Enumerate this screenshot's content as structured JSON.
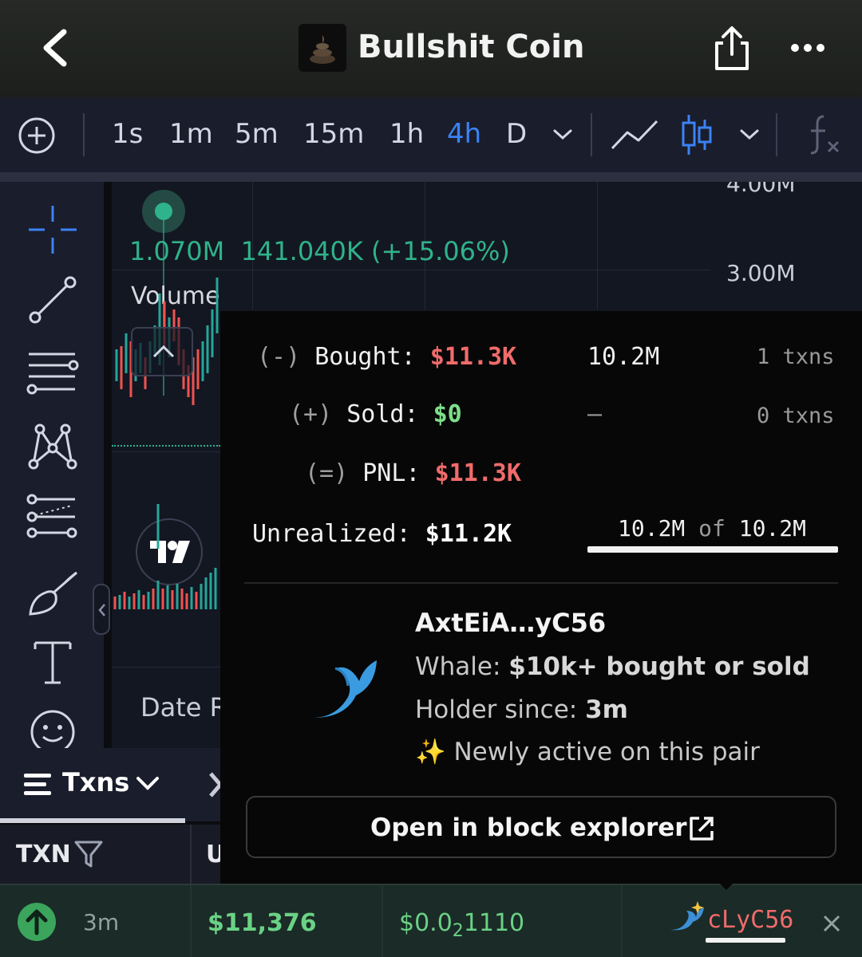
{
  "header": {
    "title": "Bullshit Coin",
    "icons": [
      "back-chevron-icon",
      "coin-logo",
      "share-icon",
      "more-icon"
    ]
  },
  "timeframes": {
    "items": [
      "1s",
      "1m",
      "5m",
      "15m",
      "1h",
      "4h",
      "D"
    ],
    "active": "4h",
    "accent_color": "#3b82f6"
  },
  "chart": {
    "price_labels": [
      "4.00M",
      "3.00M"
    ],
    "stats_value": "1.070M",
    "stats_change": "141.040K (+15.06%)",
    "volume_label": "Volume",
    "date_label": "Date R"
  },
  "txns": {
    "tab_label": "Txns",
    "column_txn": "TXN",
    "column_u": "U",
    "row": {
      "age": "3m",
      "usd": "$11,376",
      "price_prefix": "$0.0",
      "price_sub": "2",
      "price_suffix": "1110",
      "maker": "cLyC56"
    }
  },
  "popup": {
    "bought_sign": "(-)",
    "bought_label": "Bought:",
    "bought_value": "$11.3K",
    "bought_amount": "10.2M",
    "bought_txns": "1 txns",
    "sold_sign": "(+)",
    "sold_label": "Sold:",
    "sold_value": "$0",
    "sold_amount": "–",
    "sold_txns": "0 txns",
    "pnl_sign": "(=)",
    "pnl_label": "PNL:",
    "pnl_value": "$11.3K",
    "unrealized_label": "Unrealized:",
    "unrealized_value": "$11.2K",
    "holding": "10.2M",
    "holding_of": "of",
    "holding_total": "10.2M",
    "holding_fraction": 1.0,
    "wallet": "AxtEiA…yC56",
    "whale_label": "Whale:",
    "whale_value": "$10k+ bought or sold",
    "holder_label": "Holder since:",
    "holder_value": "3m",
    "newly_active": "Newly active on this pair",
    "explorer_button": "Open in block explorer"
  },
  "colors": {
    "red": "#f06b6b",
    "green": "#7ee08a",
    "teal": "#2fb38a",
    "chart_bg": "#131722",
    "toolbar_bg": "#1a1d2b"
  }
}
